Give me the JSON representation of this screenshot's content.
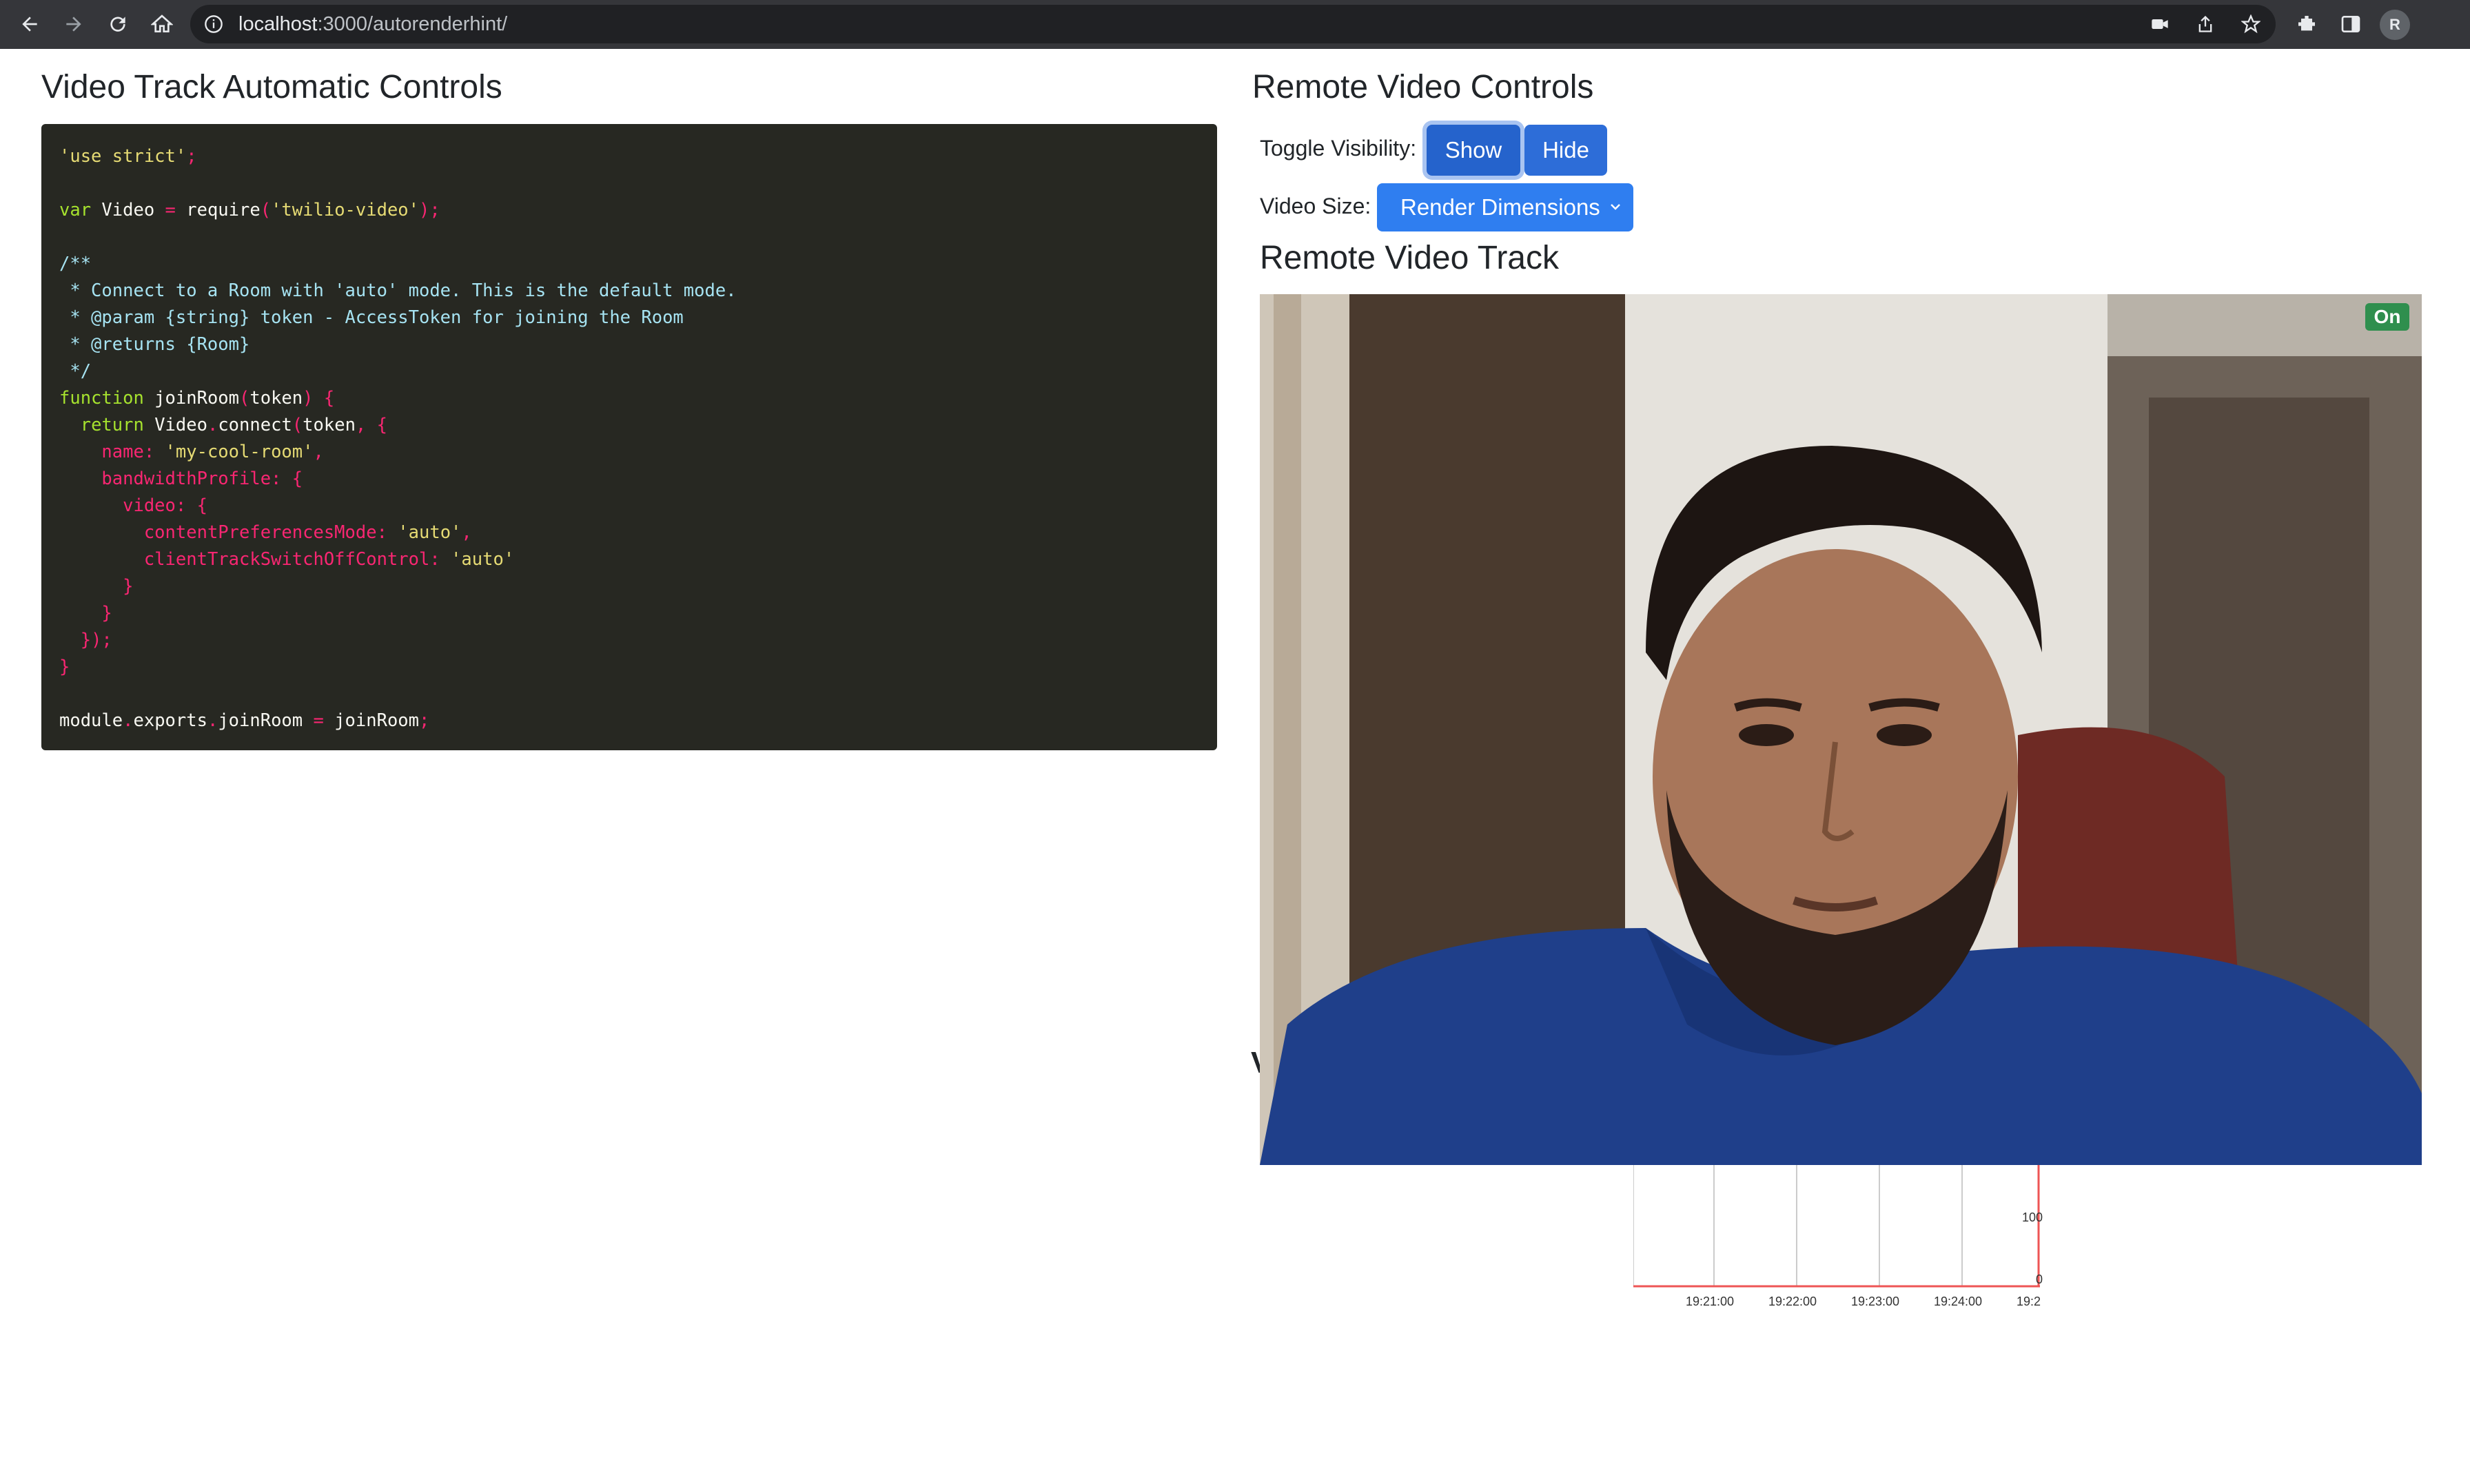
{
  "browser": {
    "url_host": "localhost",
    "url_path": ":3000/autorenderhint/",
    "avatar_letter": "R"
  },
  "left": {
    "title": "Video Track Automatic Controls"
  },
  "right": {
    "title": "Remote Video Controls",
    "toggle_label": "Toggle Visibility:",
    "show_label": "Show",
    "hide_label": "Hide",
    "size_label": "Video Size:",
    "size_selected": "Render Dimensions",
    "track_title": "Remote Video Track",
    "badge": "On"
  },
  "graph": {
    "y_labels": [
      "100",
      "0"
    ],
    "x_labels": [
      "19:21:00",
      "19:22:00",
      "19:23:00",
      "19:24:00",
      "19:2"
    ]
  },
  "colors": {
    "code_bg": "#272822",
    "button": "#2d6dd8",
    "select": "#2f7ef0",
    "badge": "#2f8f4e"
  }
}
